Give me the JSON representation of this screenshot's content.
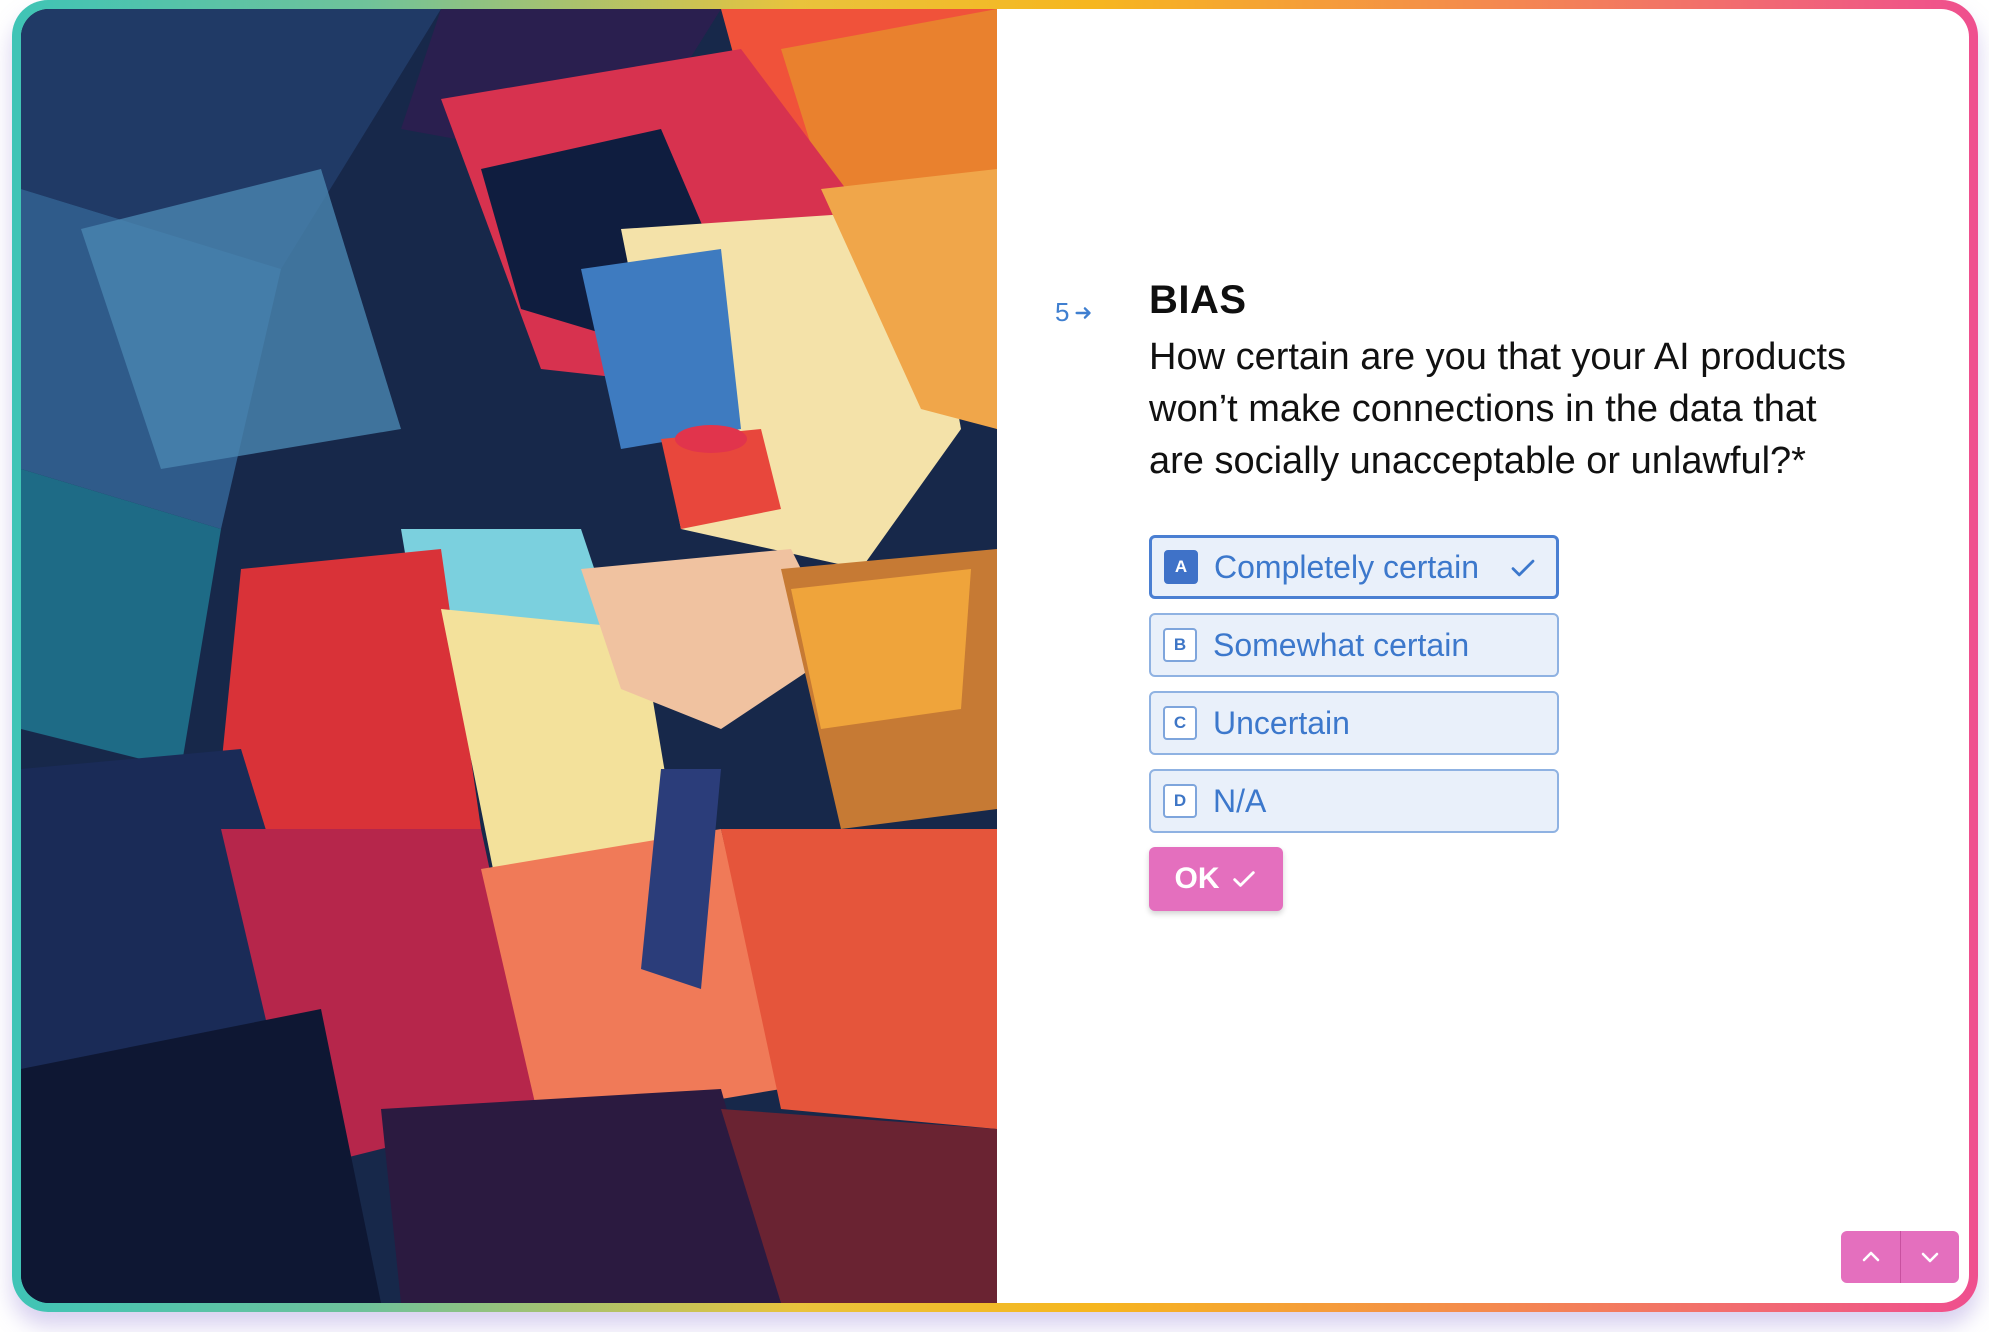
{
  "question": {
    "number": "5",
    "title": "BIAS",
    "text": "How certain are you that your AI products won’t make connections in the data that are socially unacceptable or unlawful?*",
    "options": [
      {
        "key": "A",
        "label": "Completely certain",
        "selected": true
      },
      {
        "key": "B",
        "label": "Somewhat certain",
        "selected": false
      },
      {
        "key": "C",
        "label": "Uncertain",
        "selected": false
      },
      {
        "key": "D",
        "label": "N/A",
        "selected": false
      }
    ],
    "ok_label": "OK"
  },
  "icons": {
    "question_arrow": "arrow-right-icon",
    "selected_check": "check-icon",
    "ok_check": "check-icon",
    "nav_up": "chevron-up-icon",
    "nav_down": "chevron-down-icon"
  },
  "colors": {
    "accent": "#3f7fd0",
    "option_bg": "#e9f0fa",
    "button": "#e46fbe",
    "frame_gradient": [
      "#3fc4b6",
      "#f6b61f",
      "#ef4f8f"
    ]
  }
}
